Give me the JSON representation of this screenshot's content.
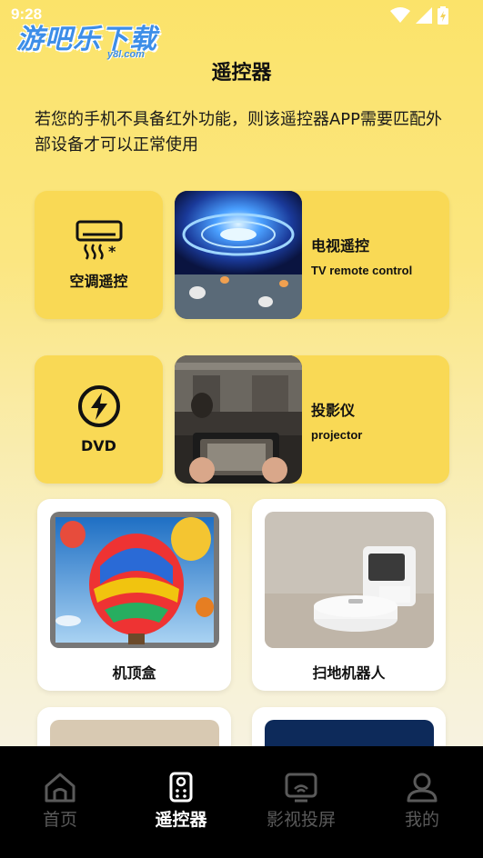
{
  "status_bar": {
    "time": "9:28"
  },
  "watermark": {
    "text": "游吧乐下载",
    "sub": "y8l.com"
  },
  "header": {
    "title": "遥控器"
  },
  "notice": "若您的手机不具备红外功能，则该遥控器APP需要匹配外部设备才可以正常使用",
  "tiles": {
    "ac": {
      "label": "空调遥控",
      "icon": "air-conditioner-icon"
    },
    "tv": {
      "title": "电视遥控",
      "subtitle": "TV remote control"
    },
    "dvd": {
      "label": "DVD",
      "icon": "lightning-icon"
    },
    "projector": {
      "title": "投影仪",
      "subtitle": "projector"
    }
  },
  "devices": [
    {
      "label": "机顶盒"
    },
    {
      "label": "扫地机器人"
    }
  ],
  "bottom_nav": {
    "items": [
      {
        "label": "首页",
        "icon": "home-icon",
        "active": false
      },
      {
        "label": "遥控器",
        "icon": "remote-icon",
        "active": true
      },
      {
        "label": "影视投屏",
        "icon": "cast-icon",
        "active": false
      },
      {
        "label": "我的",
        "icon": "profile-icon",
        "active": false
      }
    ]
  },
  "colors": {
    "accent": "#f9d955",
    "background_top": "#fbe36a",
    "nav_background": "#000000",
    "nav_active": "#ffffff",
    "nav_inactive": "#5a5a5a"
  }
}
